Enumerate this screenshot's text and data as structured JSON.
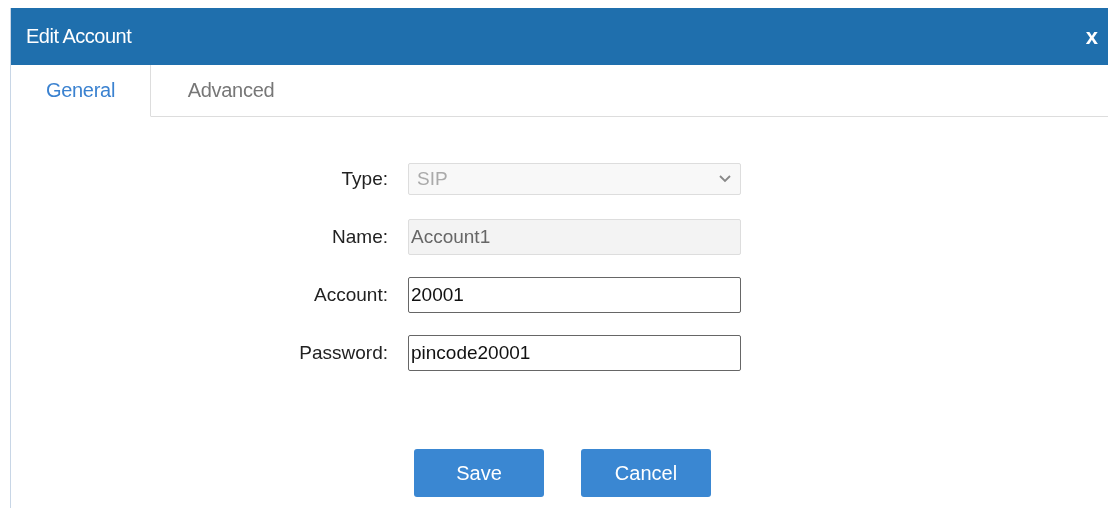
{
  "window": {
    "title": "Edit Account",
    "close": "x"
  },
  "tabs": [
    {
      "label": "General",
      "selected": true
    },
    {
      "label": "Advanced",
      "selected": false
    }
  ],
  "fields": [
    {
      "label": "Type:",
      "kind": "select",
      "value": "SIP",
      "disabled": true
    },
    {
      "label": "Name:",
      "kind": "text",
      "value": "Account1",
      "disabled": true
    },
    {
      "label": "Account:",
      "kind": "text",
      "value": "20001",
      "disabled": false
    },
    {
      "label": "Password:",
      "kind": "text",
      "value": "pincode20001",
      "disabled": false
    }
  ],
  "buttons": [
    "Save",
    "Cancel"
  ]
}
